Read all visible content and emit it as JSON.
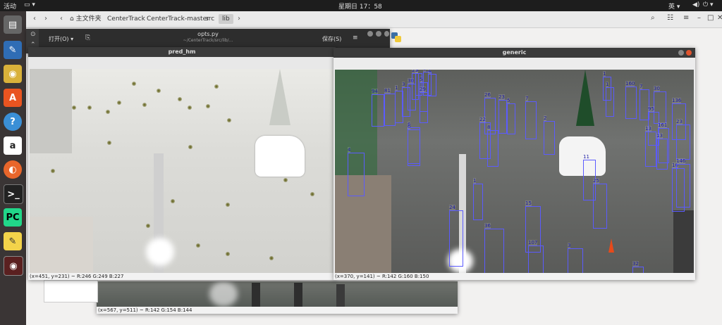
{
  "topbar": {
    "activities": "活动",
    "clock": "星期日 17：58",
    "input_method": "英"
  },
  "files": {
    "breadcrumbs": [
      "主文件夹",
      "CenterTrack",
      "CenterTrack-master",
      "src",
      "lib"
    ],
    "active_crumb": "lib"
  },
  "editor": {
    "open_label": "打开(O)",
    "filename": "opts.py",
    "path": "~/CenterTrack/src/lib/...",
    "save_label": "保存(S)"
  },
  "back_window": {
    "status": "(x=567, y=511) ~ R:142 G:154 B:144"
  },
  "pred_hm": {
    "title": "pred_hm",
    "status": "(x=451, y=231) ~ R:246 G:249 B:227"
  },
  "generic": {
    "title": "generic",
    "status": "(x=370, y=141) ~ R:142 G:160 B:150",
    "track_ids": [
      "94",
      "81",
      "1",
      "3",
      "30",
      "22",
      "9",
      "5",
      "3",
      "4",
      "29",
      "26",
      "23",
      "5",
      "7",
      "2",
      "6",
      "22",
      "8",
      "4",
      "1",
      "160",
      "7",
      "30",
      "136",
      "95",
      "13",
      "161",
      "23",
      "13",
      "11",
      "10",
      "146",
      "25",
      "24",
      "15",
      "36",
      "107",
      "3",
      "32",
      "1",
      "1",
      "6"
    ]
  },
  "colors": {
    "box": "#5b5bff",
    "label": "#1a1aa0",
    "accent": "#e95420"
  }
}
